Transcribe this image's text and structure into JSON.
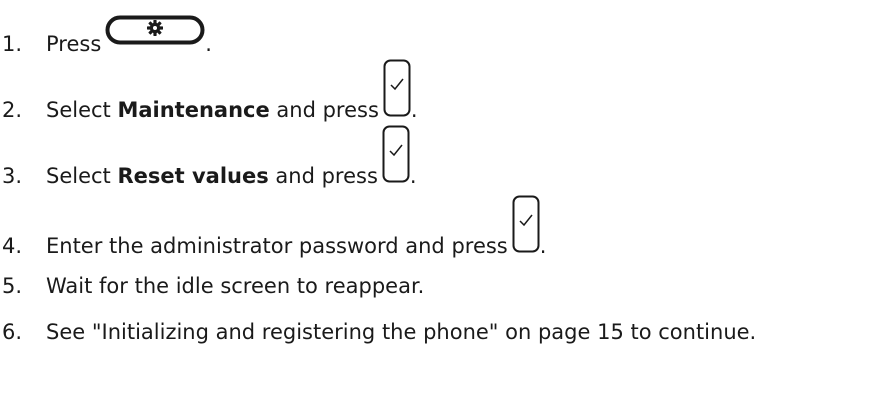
{
  "steps": [
    {
      "number": "1.",
      "before": "Press",
      "bold": "",
      "after": "",
      "key_icon": "settings-key-icon",
      "end": "."
    },
    {
      "number": "2.",
      "before": "Select ",
      "bold": "Maintenance",
      "after": " and press",
      "key_icon": "ok-check-key-icon",
      "end": "."
    },
    {
      "number": "3.",
      "before": "Select ",
      "bold": "Reset values",
      "after": " and press",
      "key_icon": "ok-check-key-icon",
      "end": "."
    },
    {
      "number": "4.",
      "before": "Enter the administrator password and press",
      "bold": "",
      "after": "",
      "key_icon": "ok-check-key-icon",
      "end": "."
    },
    {
      "number": "5.",
      "before": "Wait for the idle screen to reappear.",
      "bold": "",
      "after": "",
      "key_icon": "",
      "end": ""
    },
    {
      "number": "6.",
      "before": "See \"Initializing and registering the phone\" on page 15 to continue.",
      "bold": "",
      "after": "",
      "key_icon": "",
      "end": ""
    }
  ]
}
